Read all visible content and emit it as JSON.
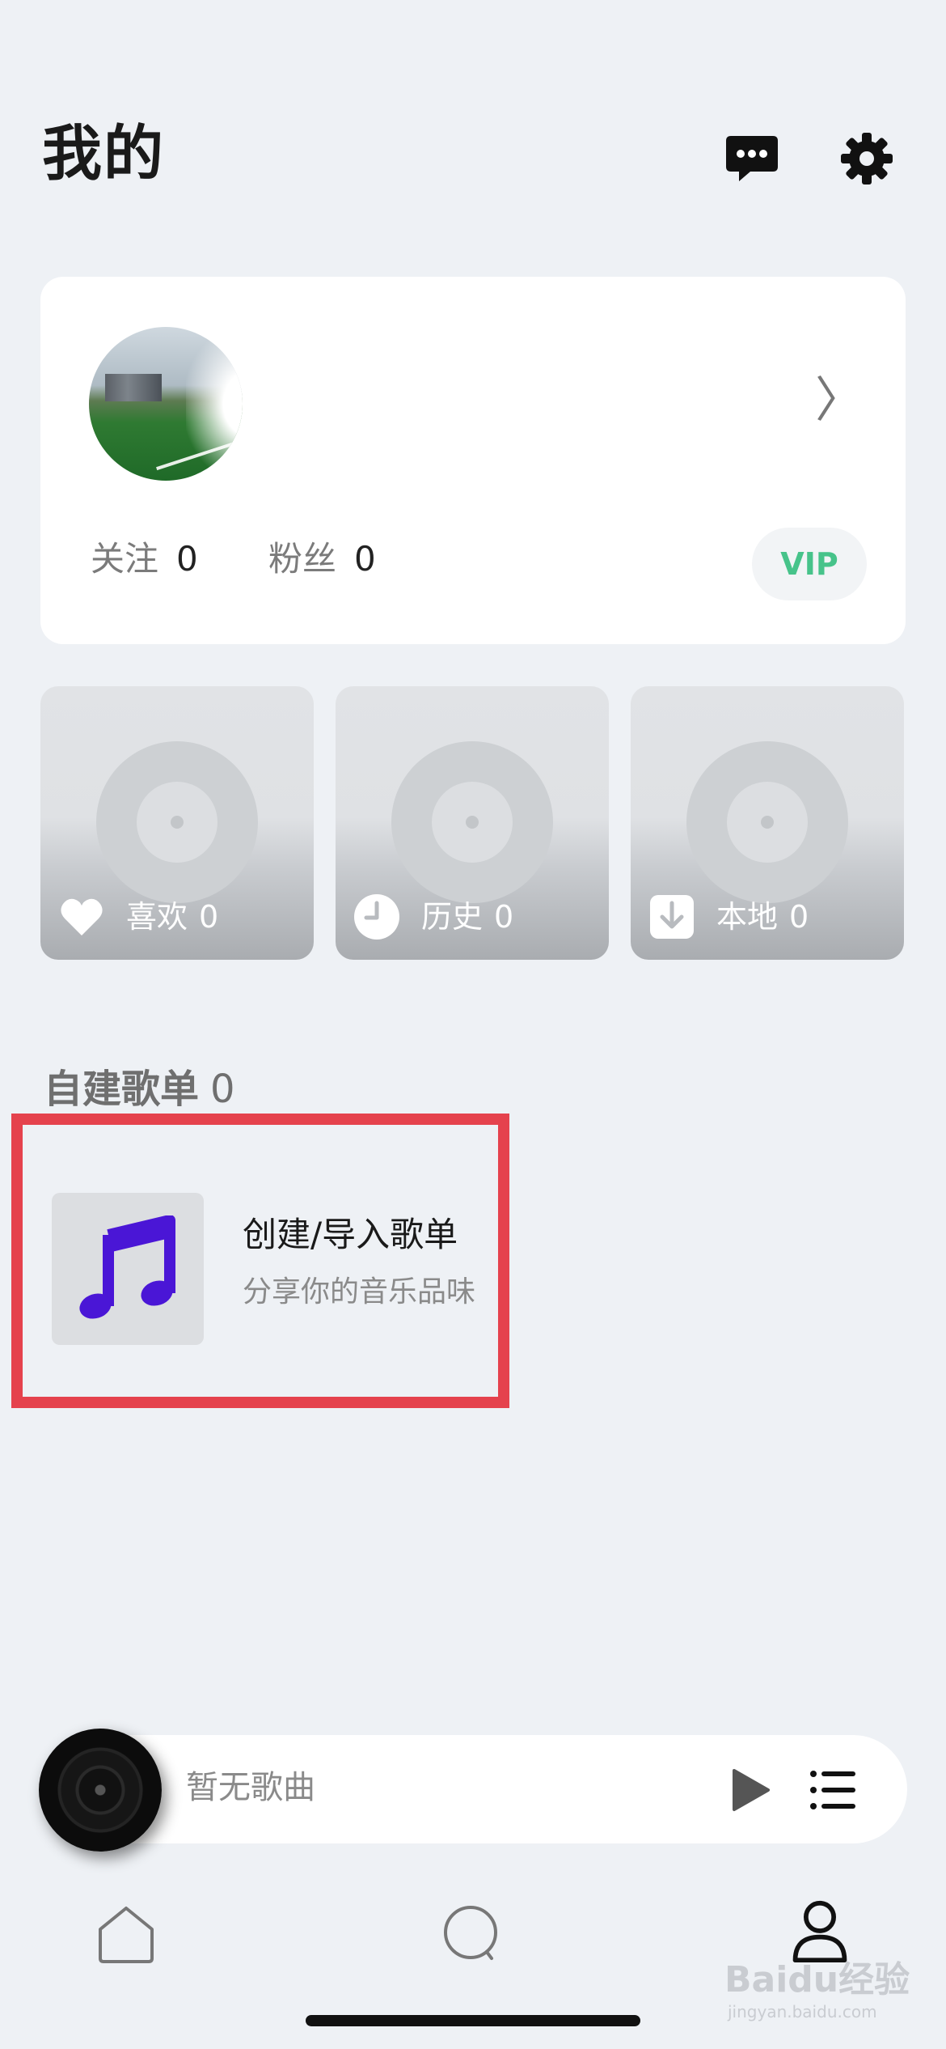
{
  "header": {
    "title": "我的",
    "message_icon": "chat-bubble-icon",
    "settings_icon": "gear-icon"
  },
  "profile": {
    "avatar": "avatar-image",
    "chevron": "〉",
    "follow_label": "关注",
    "follow_count": "0",
    "fans_label": "粉丝",
    "fans_count": "0",
    "vip_label": "VIP"
  },
  "tiles": [
    {
      "label": "喜欢",
      "count": "0",
      "icon": "heart-icon"
    },
    {
      "label": "历史",
      "count": "0",
      "icon": "clock-icon"
    },
    {
      "label": "本地",
      "count": "0",
      "icon": "download-icon"
    }
  ],
  "section": {
    "title": "自建歌单",
    "count": "0"
  },
  "playlist": {
    "title": "创建/导入歌单",
    "subtitle": "分享你的音乐品味",
    "icon": "music-note-icon"
  },
  "player": {
    "now_playing": "暂无歌曲",
    "play_icon": "play-icon",
    "queue_icon": "list-icon"
  },
  "tabs": [
    {
      "name": "home",
      "icon": "home-icon"
    },
    {
      "name": "search",
      "icon": "search-icon"
    },
    {
      "name": "mine",
      "icon": "user-icon"
    }
  ],
  "colors": {
    "background": "#eef1f5",
    "vip_green": "#47c38a",
    "highlight_red": "#e5424d",
    "music_purple": "#4a16d6"
  },
  "watermark": {
    "text": "Baidu经验",
    "sub": "jingyan.baidu.com"
  }
}
